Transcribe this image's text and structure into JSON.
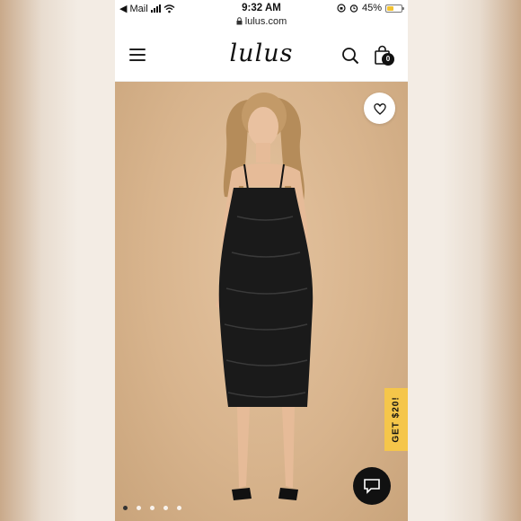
{
  "status_bar": {
    "back_label": "◀ Mail",
    "time": "9:32 AM",
    "url": "lulus.com",
    "battery": "45%",
    "battery_level": 0.45
  },
  "header": {
    "logo": "lulus",
    "cart_count": "0"
  },
  "product": {
    "image_count": 5,
    "active_image": 1
  },
  "promo": {
    "label": "GET $20!"
  },
  "icons": {
    "menu": "hamburger-menu-icon",
    "search": "search-icon",
    "cart": "shopping-bag-icon",
    "wishlist": "heart-icon",
    "chat": "chat-bubble-icon",
    "lock": "lock-icon",
    "wifi": "wifi-icon",
    "alarm": "alarm-icon",
    "orientation_lock": "orientation-lock-icon"
  },
  "colors": {
    "promo_bg": "#f5c64a",
    "chat_bg": "#111111",
    "battery_fill": "#f2c230"
  }
}
